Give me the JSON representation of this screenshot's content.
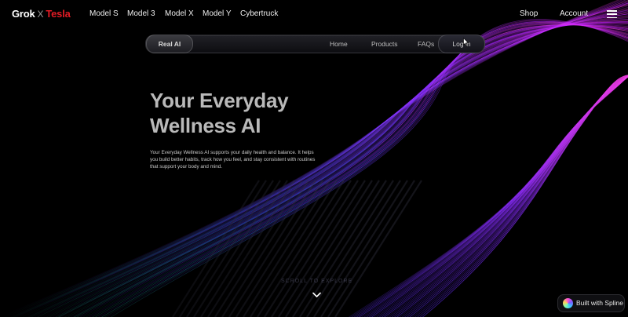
{
  "topnav": {
    "brand_primary": "Grok",
    "brand_sep": "X",
    "brand_secondary": "Tesla",
    "links": [
      "Model S",
      "Model 3",
      "Model X",
      "Model Y",
      "Cybertruck"
    ],
    "shop": "Shop",
    "account": "Account",
    "menu_icon": "hamburger-menu-icon"
  },
  "pillbar": {
    "brand": "Real AI",
    "links": [
      "Home",
      "Products",
      "FAQs"
    ],
    "login": "Log in"
  },
  "hero": {
    "title_line1": "Your Everyday",
    "title_line2": "Wellness AI",
    "description": "Your Everyday Wellness AI supports your daily health and balance. It helps you build better habits, track how you feel, and stay consistent with routines that support your body and mind."
  },
  "scroll": {
    "hint": "SCROLL TO EXPLORE",
    "icon": "chevron-down-icon"
  },
  "spline": {
    "label": "Built with Spline",
    "icon": "spline-logo-icon"
  },
  "colors": {
    "background": "#000000",
    "tesla_red": "#e01b24",
    "wave_purple": "#7a2cff",
    "wave_magenta": "#d21cff",
    "wave_teal": "#1fb8a8",
    "wave_blue": "#3a5bff"
  }
}
